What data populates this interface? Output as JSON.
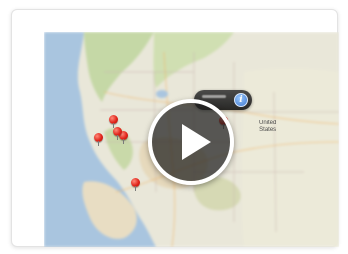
{
  "video_card": {
    "map_label_line1": "United",
    "map_label_line2": "States",
    "play_icon": "play-icon",
    "info_icon": "info-icon",
    "info_glyph": "i",
    "pin_color": "#e0241a",
    "callout_color": "#1e1e1e"
  }
}
